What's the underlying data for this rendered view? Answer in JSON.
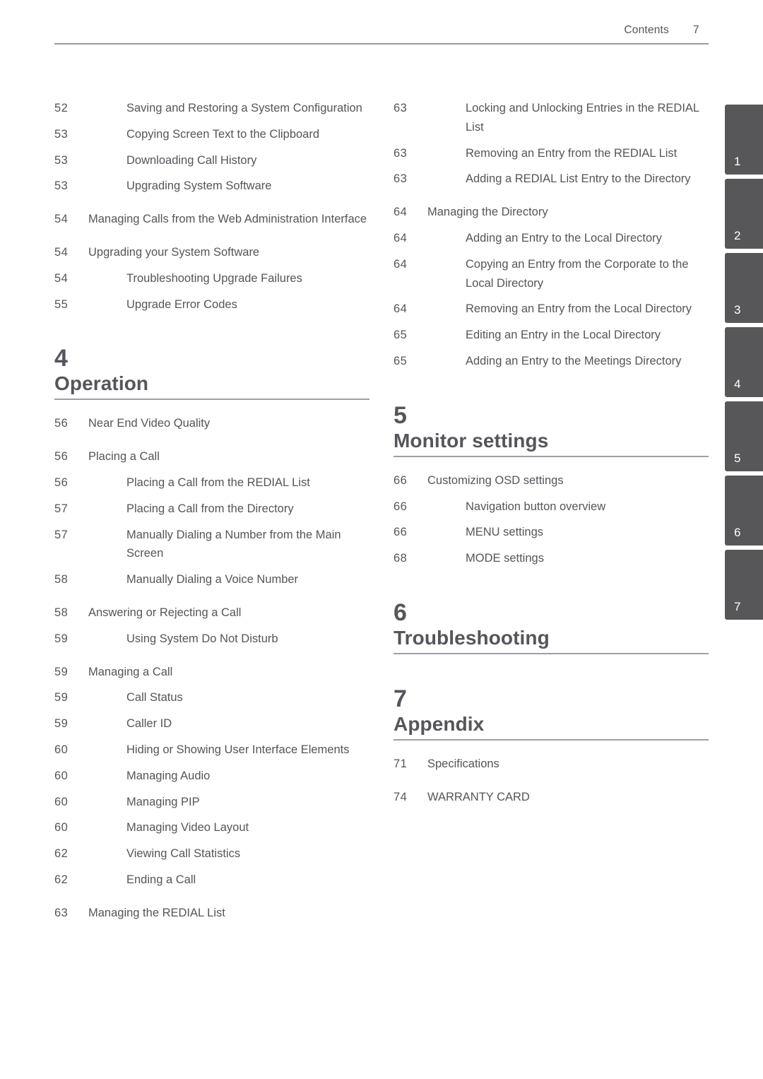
{
  "header": {
    "label": "Contents",
    "page_number": "7"
  },
  "columns": {
    "left": [
      {
        "kind": "entry",
        "level": 2,
        "page": "52",
        "title": "Saving and Restoring a System Configuration"
      },
      {
        "kind": "entry",
        "level": 2,
        "page": "53",
        "title": "Copying Screen Text to the Clipboard"
      },
      {
        "kind": "entry",
        "level": 2,
        "page": "53",
        "title": "Downloading Call History"
      },
      {
        "kind": "entry",
        "level": 2,
        "page": "53",
        "title": "Upgrading System Software"
      },
      {
        "kind": "entry",
        "level": 1,
        "page": "54",
        "title": "Managing Calls from the Web Administration Interface"
      },
      {
        "kind": "entry",
        "level": 1,
        "page": "54",
        "title": "Upgrading your System Software"
      },
      {
        "kind": "entry",
        "level": 2,
        "page": "54",
        "title": "Troubleshooting Upgrade Failures"
      },
      {
        "kind": "entry",
        "level": 2,
        "page": "55",
        "title": "Upgrade Error Codes"
      },
      {
        "kind": "heading",
        "number": "4",
        "title": "Operation"
      },
      {
        "kind": "entry",
        "level": 1,
        "page": "56",
        "title": "Near End Video Quality"
      },
      {
        "kind": "entry",
        "level": 1,
        "page": "56",
        "title": "Placing a Call"
      },
      {
        "kind": "entry",
        "level": 2,
        "page": "56",
        "title": "Placing a Call from the REDIAL List"
      },
      {
        "kind": "entry",
        "level": 2,
        "page": "57",
        "title": "Placing a Call from the Directory"
      },
      {
        "kind": "entry",
        "level": 2,
        "page": "57",
        "title": "Manually Dialing a Number from the Main Screen"
      },
      {
        "kind": "entry",
        "level": 2,
        "page": "58",
        "title": "Manually Dialing a Voice Number"
      },
      {
        "kind": "entry",
        "level": 1,
        "page": "58",
        "title": "Answering or Rejecting a Call"
      },
      {
        "kind": "entry",
        "level": 2,
        "page": "59",
        "title": "Using System Do Not Disturb"
      },
      {
        "kind": "entry",
        "level": 1,
        "page": "59",
        "title": "Managing a Call"
      },
      {
        "kind": "entry",
        "level": 2,
        "page": "59",
        "title": "Call Status"
      },
      {
        "kind": "entry",
        "level": 2,
        "page": "59",
        "title": "Caller ID"
      },
      {
        "kind": "entry",
        "level": 2,
        "page": "60",
        "title": "Hiding or Showing User Interface Elements"
      },
      {
        "kind": "entry",
        "level": 2,
        "page": "60",
        "title": "Managing Audio"
      },
      {
        "kind": "entry",
        "level": 2,
        "page": "60",
        "title": "Managing PIP"
      },
      {
        "kind": "entry",
        "level": 2,
        "page": "60",
        "title": "Managing Video Layout"
      },
      {
        "kind": "entry",
        "level": 2,
        "page": "62",
        "title": "Viewing Call Statistics"
      },
      {
        "kind": "entry",
        "level": 2,
        "page": "62",
        "title": "Ending a Call"
      },
      {
        "kind": "entry",
        "level": 1,
        "page": "63",
        "title": "Managing the REDIAL List"
      }
    ],
    "right": [
      {
        "kind": "entry",
        "level": 2,
        "page": "63",
        "title": "Locking and Unlocking Entries in the REDIAL List"
      },
      {
        "kind": "entry",
        "level": 2,
        "page": "63",
        "title": "Removing an Entry from the REDIAL List"
      },
      {
        "kind": "entry",
        "level": 2,
        "page": "63",
        "title": "Adding a REDIAL List Entry to the Directory"
      },
      {
        "kind": "entry",
        "level": 1,
        "page": "64",
        "title": "Managing the Directory"
      },
      {
        "kind": "entry",
        "level": 2,
        "page": "64",
        "title": "Adding an Entry to the Local Directory"
      },
      {
        "kind": "entry",
        "level": 2,
        "page": "64",
        "title": "Copying an Entry from the Corporate to the Local Directory"
      },
      {
        "kind": "entry",
        "level": 2,
        "page": "64",
        "title": "Removing an Entry from the Local Directory"
      },
      {
        "kind": "entry",
        "level": 2,
        "page": "65",
        "title": "Editing an Entry in the Local Directory"
      },
      {
        "kind": "entry",
        "level": 2,
        "page": "65",
        "title": "Adding an Entry to the Meetings Directory"
      },
      {
        "kind": "heading",
        "number": "5",
        "title": "Monitor settings"
      },
      {
        "kind": "entry",
        "level": 1,
        "page": "66",
        "title": "Customizing OSD settings"
      },
      {
        "kind": "entry",
        "level": 2,
        "page": "66",
        "title": "Navigation button overview"
      },
      {
        "kind": "entry",
        "level": 2,
        "page": "66",
        "title": "MENU settings"
      },
      {
        "kind": "entry",
        "level": 2,
        "page": "68",
        "title": "MODE settings"
      },
      {
        "kind": "heading",
        "number": "6",
        "title": "Troubleshooting"
      },
      {
        "kind": "heading",
        "number": "7",
        "title": "Appendix"
      },
      {
        "kind": "entry",
        "level": 1,
        "page": "71",
        "title": "Specifications"
      },
      {
        "kind": "entry",
        "level": 1,
        "page": "74",
        "title": "WARRANTY CARD"
      }
    ]
  },
  "chapter_tabs": [
    "1",
    "2",
    "3",
    "4",
    "5",
    "6",
    "7"
  ],
  "colors": {
    "text": "#55555b",
    "header_rule": "#9a9a9e",
    "chapter_rule": "#a79aa6",
    "tab_background": "#575759",
    "tab_number": "#ffffff"
  }
}
